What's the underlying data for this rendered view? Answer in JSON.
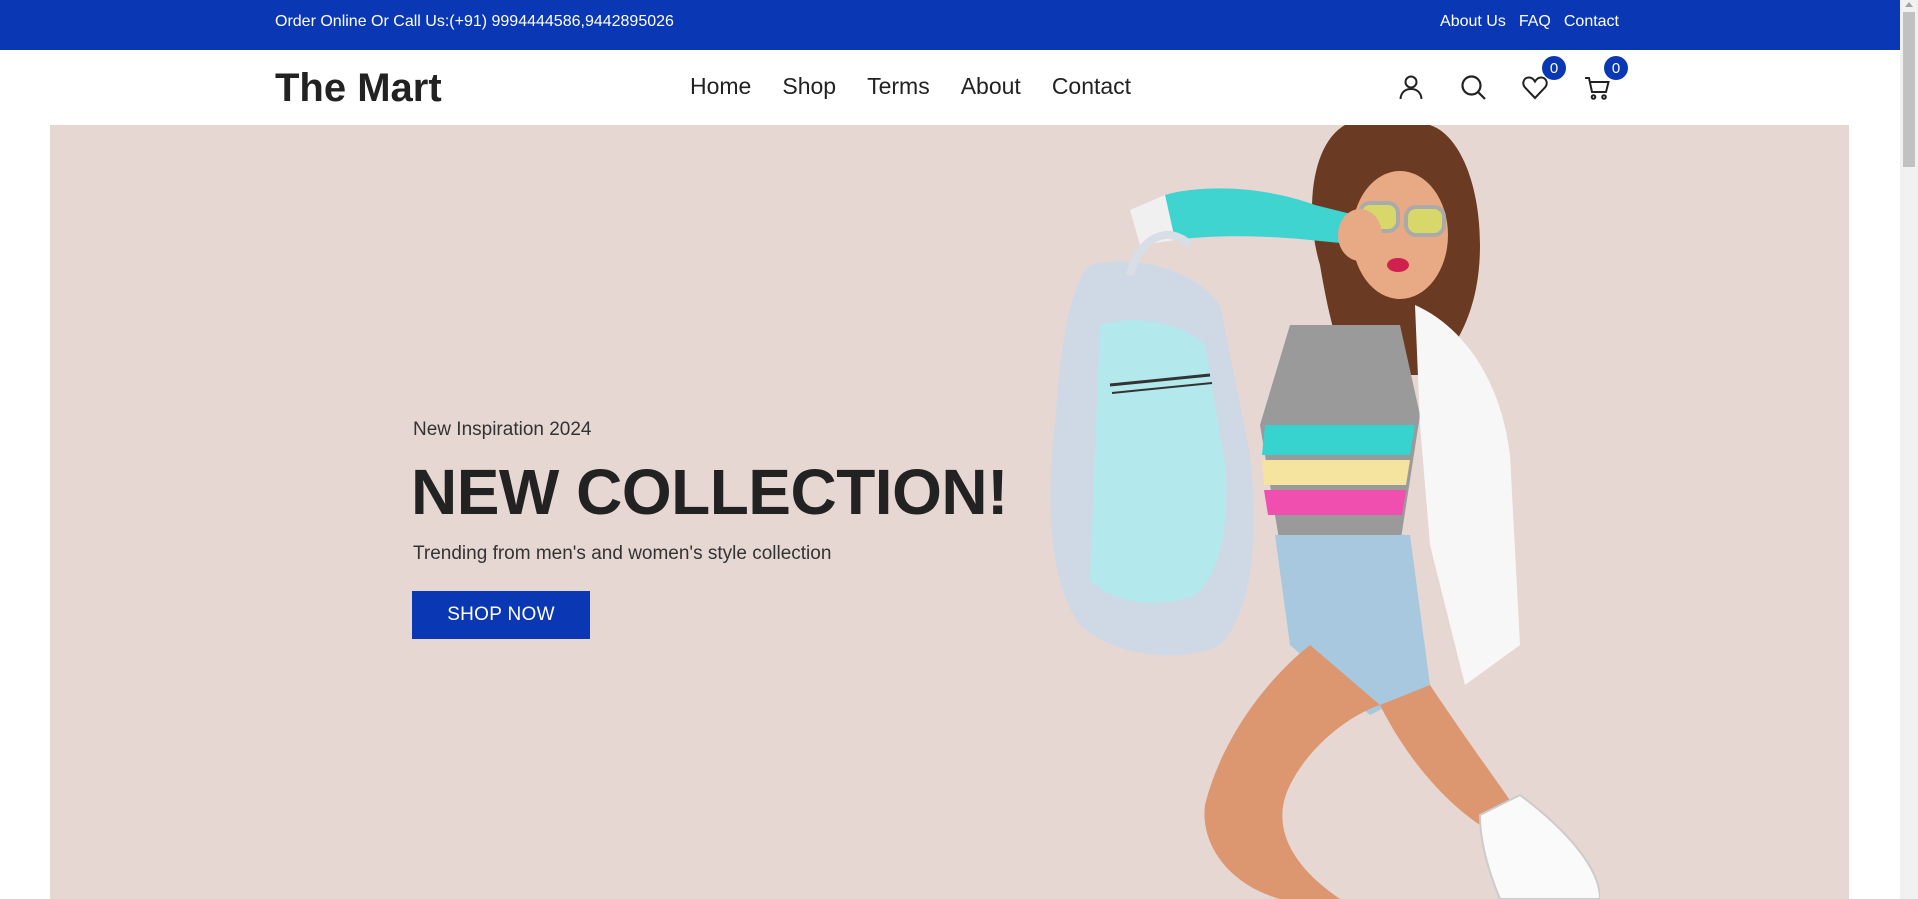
{
  "topbar": {
    "callus": "Order Online Or Call Us:(+91) 9994444586,9442895026",
    "links": [
      "About Us",
      "FAQ",
      "Contact"
    ]
  },
  "header": {
    "logo": "The Mart",
    "nav": [
      "Home",
      "Shop",
      "Terms",
      "About",
      "Contact"
    ],
    "icons": {
      "account": "user-icon",
      "search": "search-icon",
      "wishlist": "heart-icon",
      "cart": "cart-icon"
    },
    "wishlist_count": "0",
    "cart_count": "0"
  },
  "hero": {
    "subtitle": "New Inspiration 2024",
    "title": "NEW COLLECTION!",
    "description": "Trending from men's and women's style collection",
    "button": "SHOP NOW"
  },
  "colors": {
    "brand": "#0a38b5",
    "hero_bg": "#e6d7d3",
    "text": "#222222"
  }
}
